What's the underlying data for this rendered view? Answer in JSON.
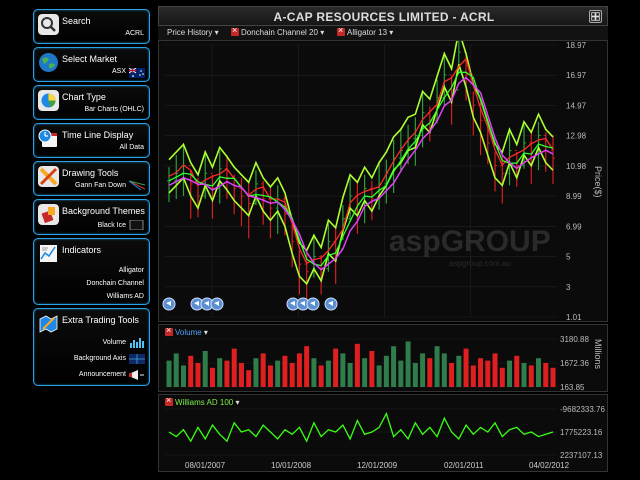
{
  "sidebar": {
    "search": {
      "title": "Search",
      "value": "ACRL"
    },
    "market": {
      "title": "Select Market",
      "value": "ASX"
    },
    "chart_type": {
      "title": "Chart Type",
      "value": "Bar Charts (OHLC)"
    },
    "timeline": {
      "title": "Time Line Display",
      "value": "All Data"
    },
    "drawing": {
      "title": "Drawing Tools",
      "value": "Gann Fan Down"
    },
    "background": {
      "title": "Background Themes",
      "value": "Black Ice"
    },
    "indicators": {
      "title": "Indicators",
      "items": [
        "Alligator",
        "Donchain Channel",
        "Williams AD"
      ]
    },
    "extra": {
      "title": "Extra Trading Tools",
      "items": [
        "Volume",
        "Background Axis",
        "Announcement"
      ]
    }
  },
  "chart": {
    "title": "A-CAP RESOURCES LIMITED - ACRL",
    "price_history": "Price History",
    "donchain": "Donchain Channel 20",
    "alligator": "Alligator 13",
    "volume_label": "Volume",
    "williams_label": "Williams AD 100",
    "price_axis_label": "Price($)",
    "volume_axis_label": "Millions",
    "watermark": "aspGROUP",
    "watermark_sub": "aspgroup.com.au",
    "price_ticks": [
      "18.97",
      "16.97",
      "14.97",
      "12.98",
      "10.98",
      "8.99",
      "6.99",
      "5",
      "3",
      "1.01"
    ],
    "volume_ticks": [
      "3180.88",
      "1672.36",
      "163.85"
    ],
    "williams_ticks": [
      "-9682333.76",
      "1775223.16",
      "2237107.13"
    ],
    "x_ticks": [
      "08/01/2007",
      "10/01/2008",
      "12/01/2009",
      "02/01/2011",
      "04/02/2012"
    ]
  },
  "chart_data": {
    "type": "line",
    "x": [
      "08/01/2007",
      "10/01/2008",
      "12/01/2009",
      "02/01/2011",
      "04/02/2012"
    ],
    "price": [
      10.0,
      10.5,
      11.0,
      9.8,
      9.0,
      10.5,
      9.5,
      10.8,
      10.2,
      9.5,
      9.0,
      8.5,
      9.8,
      8.8,
      8.2,
      8.8,
      7.8,
      6.0,
      4.5,
      4.0,
      5.0,
      4.2,
      6.0,
      5.5,
      7.5,
      9.0,
      8.5,
      9.5,
      8.8,
      9.8,
      10.5,
      11.5,
      12.0,
      12.8,
      13.0,
      14.5,
      14.0,
      15.5,
      17.0,
      16.0,
      18.5,
      17.0,
      15.0,
      14.0,
      12.5,
      11.0,
      10.5,
      12.0,
      11.0,
      12.5,
      11.8,
      13.0,
      12.0,
      11.5
    ],
    "volume": [
      0.55,
      0.7,
      0.45,
      0.65,
      0.5,
      0.75,
      0.4,
      0.6,
      0.55,
      0.8,
      0.5,
      0.35,
      0.6,
      0.7,
      0.45,
      0.55,
      0.65,
      0.5,
      0.7,
      0.85,
      0.6,
      0.45,
      0.55,
      0.8,
      0.7,
      0.5,
      0.9,
      0.6,
      0.75,
      0.45,
      0.65,
      0.85,
      0.55,
      0.95,
      0.5,
      0.7,
      0.6,
      0.85,
      0.7,
      0.5,
      0.65,
      0.8,
      0.45,
      0.6,
      0.55,
      0.7,
      0.4,
      0.55,
      0.65,
      0.5,
      0.45,
      0.6,
      0.5,
      0.4
    ],
    "williams": [
      0.5,
      0.4,
      0.55,
      0.3,
      0.6,
      0.35,
      0.65,
      0.45,
      0.3,
      0.7,
      0.5,
      0.55,
      0.4,
      0.65,
      0.5,
      0.35,
      0.55,
      0.45,
      0.6,
      0.3,
      0.7,
      0.4,
      0.55,
      0.5,
      0.65,
      0.35,
      0.75,
      0.45,
      0.5,
      0.6,
      0.9,
      0.4,
      0.55,
      0.35,
      0.7,
      0.45,
      0.6,
      0.4,
      0.8,
      0.5,
      0.35,
      0.65,
      0.45,
      0.6,
      0.5,
      0.7,
      0.4,
      0.55,
      0.6,
      0.45,
      0.5,
      0.4,
      0.45,
      0.5
    ],
    "ylim": [
      1.01,
      18.97
    ]
  }
}
